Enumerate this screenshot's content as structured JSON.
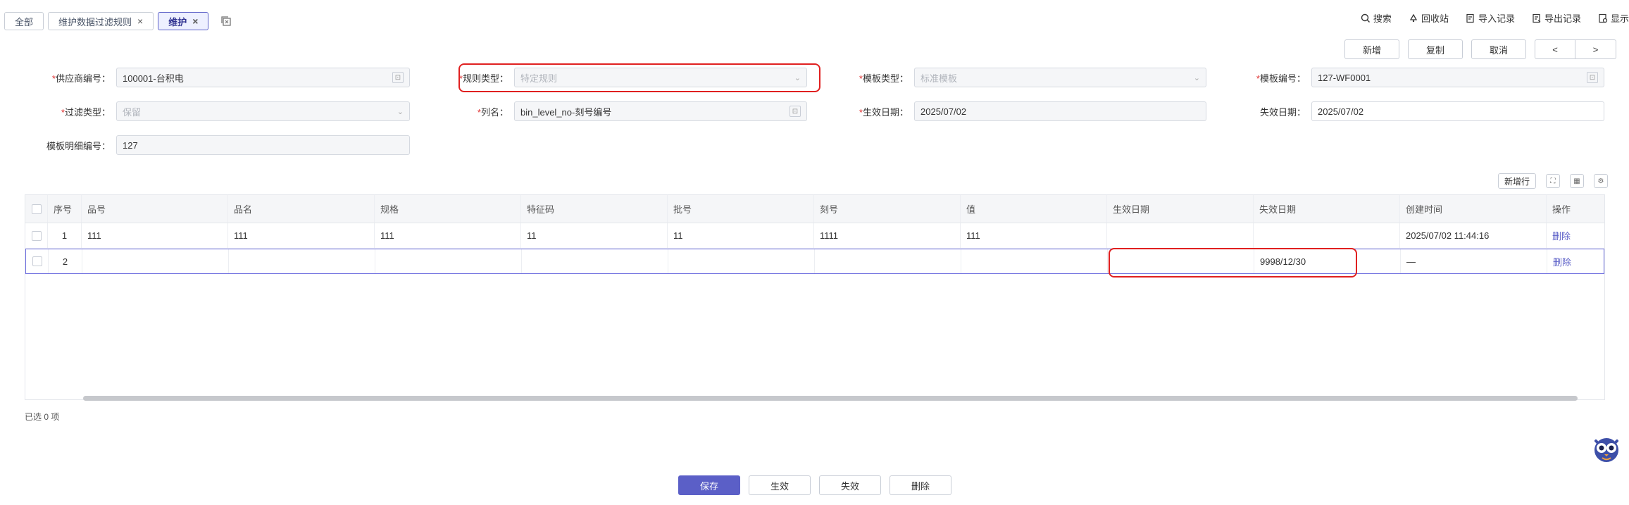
{
  "tabs": [
    {
      "label": "全部",
      "closable": false,
      "active": false
    },
    {
      "label": "维护数据过滤规则",
      "closable": true,
      "active": false
    },
    {
      "label": "维护",
      "closable": true,
      "active": true
    }
  ],
  "top_actions": {
    "search": "搜索",
    "recycle": "回收站",
    "import_log": "导入记录",
    "export_log": "导出记录",
    "display": "显示"
  },
  "nav_buttons": {
    "new": "新增",
    "copy": "复制",
    "cancel": "取消",
    "prev": "<",
    "next": ">"
  },
  "form": {
    "supplier": {
      "label": "供应商编号：",
      "value": "100001-台积电",
      "required": true
    },
    "rule_type": {
      "label": "规则类型：",
      "value": "特定规则",
      "required": true
    },
    "template_type": {
      "label": "模板类型：",
      "value": "标准模板",
      "required": true
    },
    "template_no": {
      "label": "模板编号：",
      "value": "127-WF0001",
      "required": true
    },
    "filter_type": {
      "label": "过滤类型：",
      "value": "保留",
      "required": true
    },
    "column_name": {
      "label": "列名：",
      "value": "bin_level_no-刻号编号",
      "required": true
    },
    "effective_date": {
      "label": "生效日期：",
      "value": "2025/07/02",
      "required": true
    },
    "expiry_date": {
      "label": "失效日期：",
      "value": "2025/07/02",
      "required": false
    },
    "detail_no": {
      "label": "模板明细编号：",
      "value": "127",
      "required": false
    }
  },
  "table_toolbar": {
    "new_row": "新增行"
  },
  "table": {
    "columns": [
      "序号",
      "品号",
      "品名",
      "规格",
      "特征码",
      "批号",
      "刻号",
      "值",
      "生效日期",
      "失效日期",
      "创建时间",
      "操作"
    ],
    "rows": [
      {
        "seq": "1",
        "part_no": "111",
        "part_name": "111",
        "spec": "111",
        "feature": "11",
        "lot": "11",
        "engrave": "1111",
        "value": "111",
        "eff": "",
        "exp": "",
        "created": "2025/07/02 11:44:16",
        "op": "删除"
      },
      {
        "seq": "2",
        "part_no": "",
        "part_name": "",
        "spec": "",
        "feature": "",
        "lot": "",
        "engrave": "",
        "value": "",
        "eff": "",
        "exp": "9998/12/30",
        "created": "—",
        "op": "删除"
      }
    ]
  },
  "selected_count": "已选 0 项",
  "bottom_buttons": {
    "save": "保存",
    "activate": "生效",
    "deactivate": "失效",
    "delete": "删除"
  },
  "colors": {
    "accent": "#5b5fc7",
    "required": "#e03131",
    "highlight": "#e02020"
  }
}
